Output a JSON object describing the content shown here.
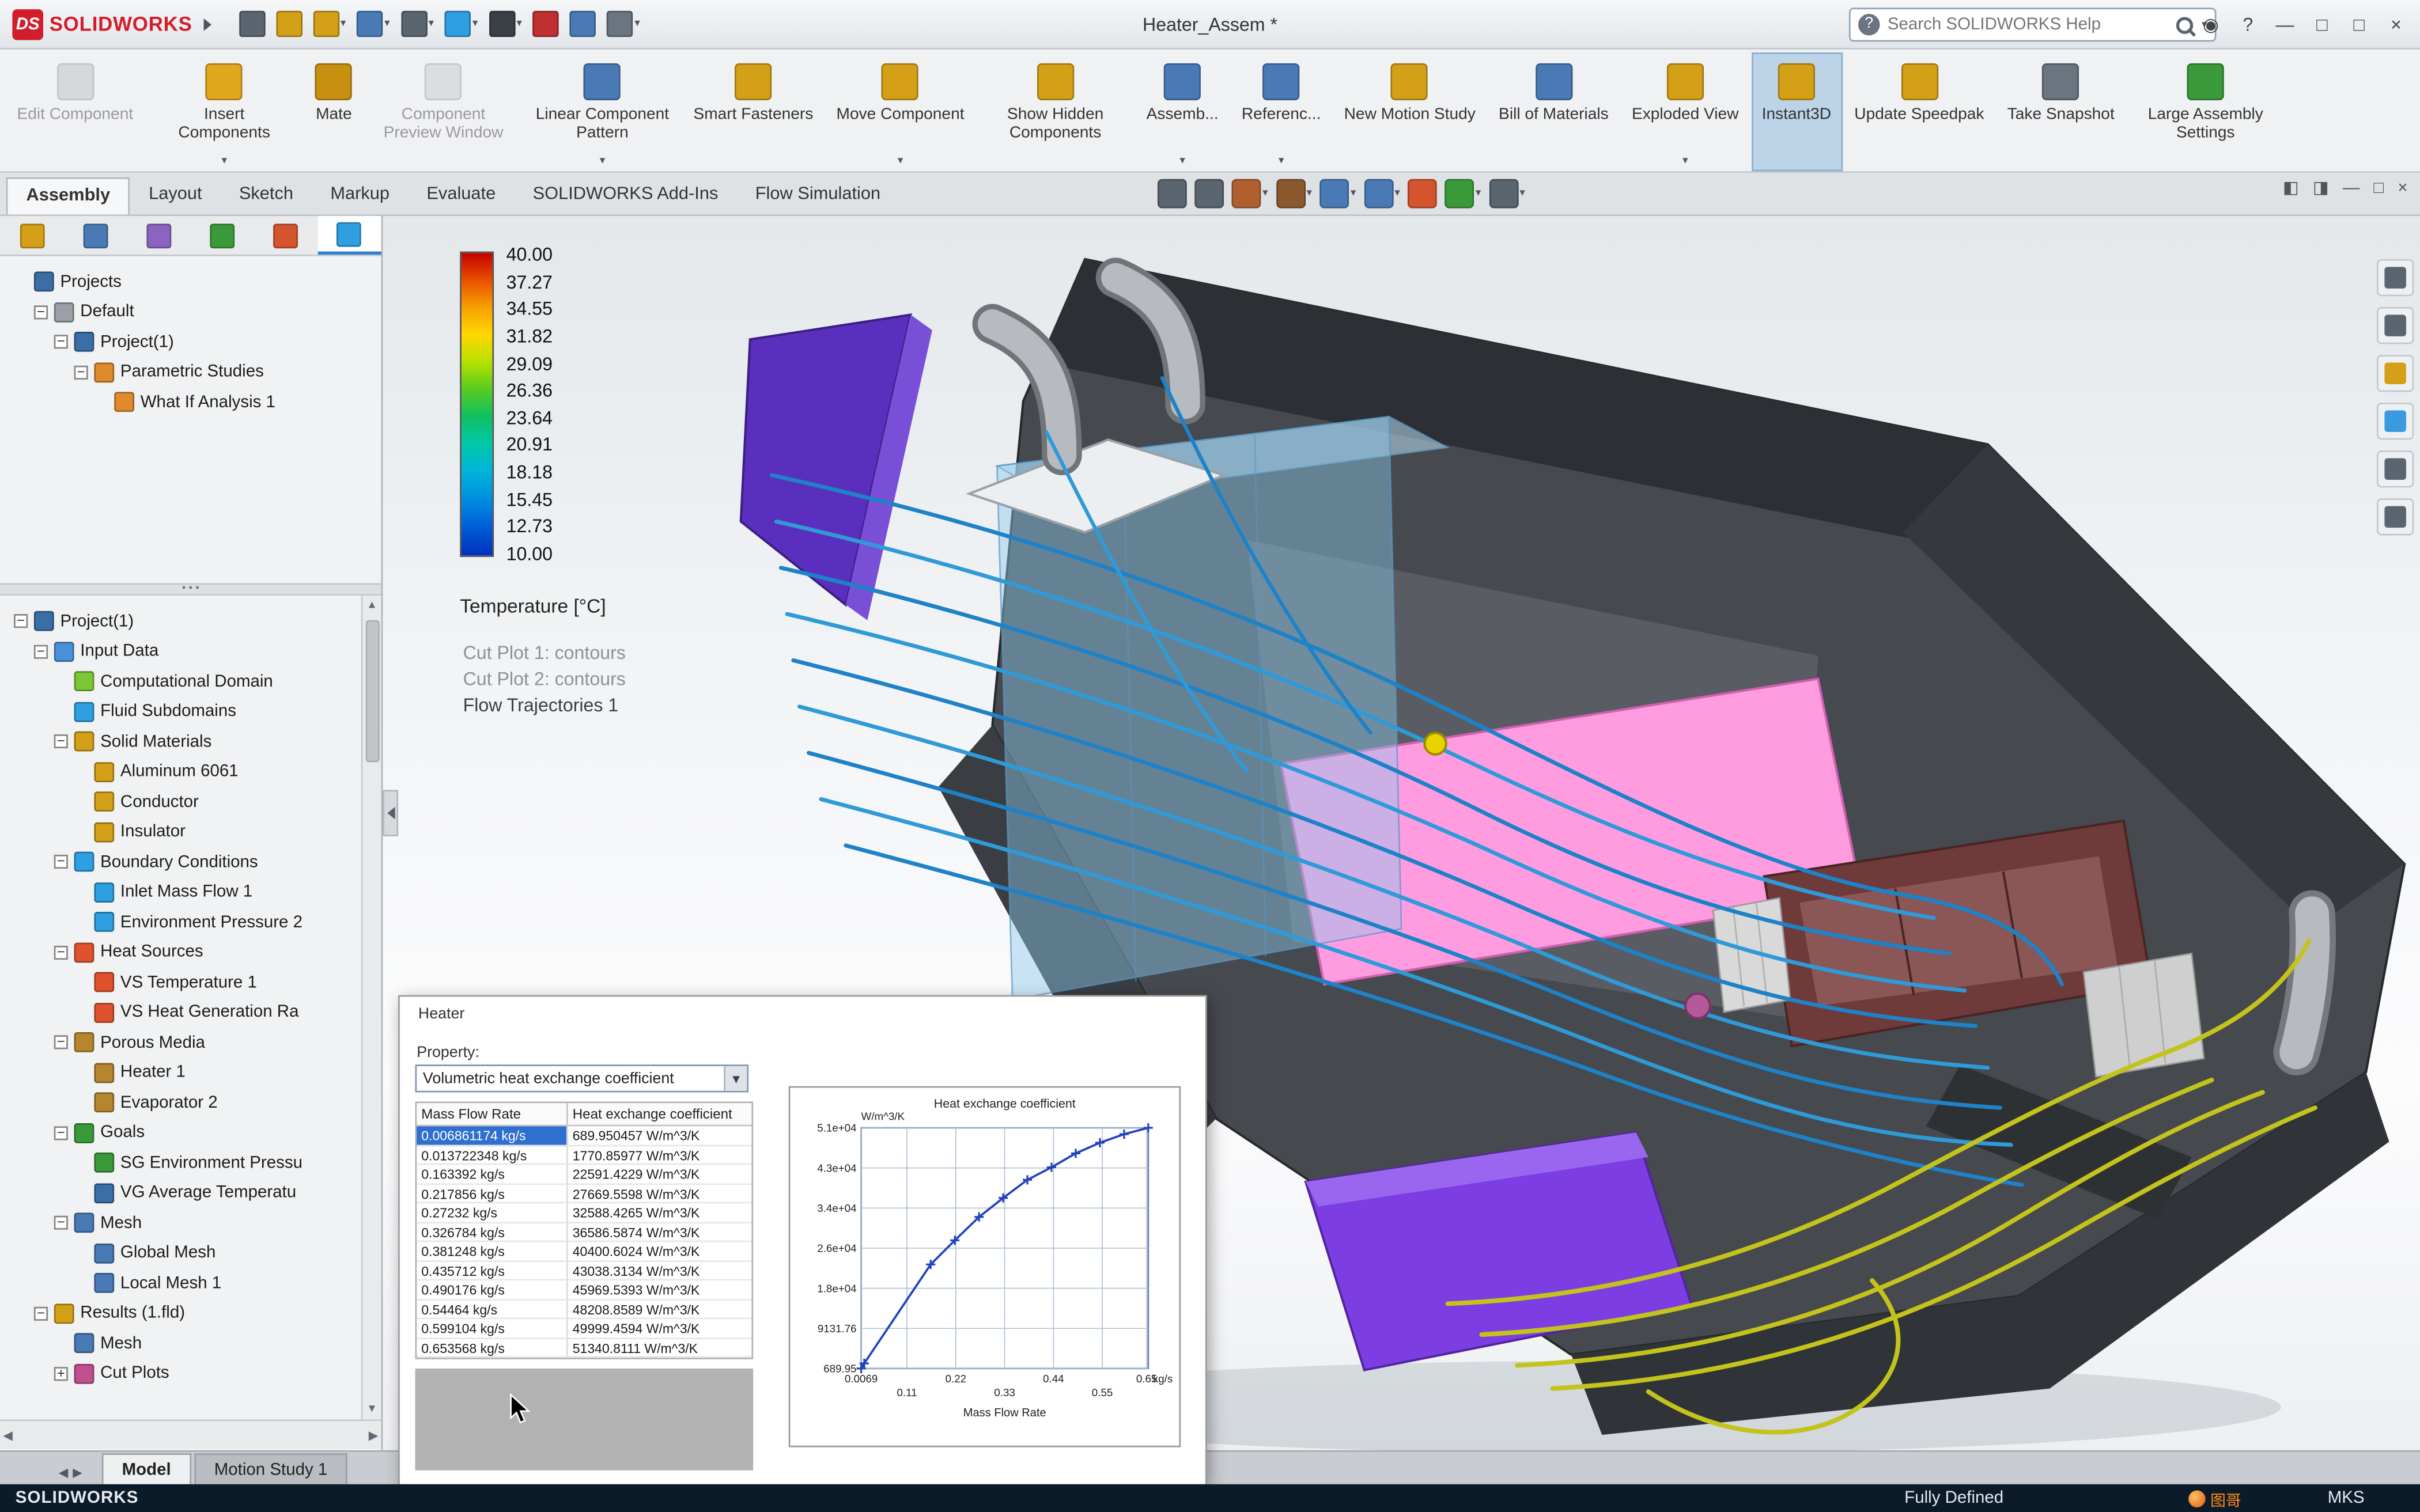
{
  "titlebar": {
    "brand_mark": "DS",
    "brand": "SOLIDWORKS",
    "title": "Heater_Assem *",
    "search": {
      "placeholder": "Search SOLIDWORKS Help",
      "help_glyph": "?"
    },
    "tool_icons": [
      {
        "icon": "home-icon",
        "color": "#5a6570"
      },
      {
        "icon": "new-document-icon",
        "color": "#d4a017"
      },
      {
        "icon": "open-icon",
        "color": "#d4a017",
        "dropdown": true
      },
      {
        "icon": "save-icon",
        "color": "#4a7ab5",
        "dropdown": true
      },
      {
        "icon": "print-icon",
        "color": "#5a6570",
        "dropdown": true
      },
      {
        "icon": "undo-icon",
        "color": "#2e9fe0",
        "dropdown": true
      },
      {
        "icon": "select-arrow-icon",
        "color": "#3b4046",
        "dropdown": true
      },
      {
        "icon": "mate-reference-icon",
        "color": "#c03030"
      },
      {
        "icon": "design-table-icon",
        "color": "#4a7ab5"
      },
      {
        "icon": "options-gear-icon",
        "color": "#6a7580",
        "dropdown": true
      }
    ],
    "window_controls": [
      {
        "icon": "user-icon",
        "glyph": "◉"
      },
      {
        "icon": "help-icon",
        "glyph": "?"
      },
      {
        "icon": "minimize-icon",
        "glyph": "—"
      },
      {
        "icon": "restore-icon",
        "glyph": "□"
      },
      {
        "icon": "maximize-icon",
        "glyph": "□"
      },
      {
        "icon": "close-icon",
        "glyph": "×"
      }
    ]
  },
  "ribbon": [
    {
      "label": "Edit Component",
      "icon": "edit-component-icon",
      "color": "#b9bcc0",
      "disabled": true
    },
    {
      "label": "Insert Components",
      "icon": "insert-components-icon",
      "color": "#e0a81f",
      "dropdown": true
    },
    {
      "label": "Mate",
      "icon": "mate-icon",
      "color": "#c89010"
    },
    {
      "label": "Component Preview Window",
      "icon": "component-preview-window-icon",
      "color": "#c3c6ca",
      "disabled": true
    },
    {
      "label": "Linear Component Pattern",
      "icon": "linear-component-pattern-icon",
      "color": "#4a7ab5",
      "dropdown": true
    },
    {
      "label": "Smart Fasteners",
      "icon": "smart-fasteners-icon",
      "color": "#d4a017"
    },
    {
      "label": "Move Component",
      "icon": "move-component-icon",
      "color": "#d4a017",
      "dropdown": true
    },
    {
      "label": "Show Hidden Components",
      "icon": "show-hidden-components-icon",
      "color": "#d4a017"
    },
    {
      "label": "Assemb...",
      "icon": "assembly-features-icon",
      "color": "#4a7ab5",
      "dropdown": true
    },
    {
      "label": "Referenc...",
      "icon": "reference-geometry-icon",
      "color": "#4a7ab5",
      "dropdown": true
    },
    {
      "label": "New Motion Study",
      "icon": "new-motion-study-icon",
      "color": "#d4a017"
    },
    {
      "label": "Bill of Materials",
      "icon": "bill-of-materials-icon",
      "color": "#4a7ab5"
    },
    {
      "label": "Exploded View",
      "icon": "exploded-view-icon",
      "color": "#d4a017",
      "dropdown": true
    },
    {
      "label": "Instant3D",
      "icon": "instant3d-icon",
      "color": "#d4a017",
      "active": true
    },
    {
      "label": "Update Speedpak",
      "icon": "update-speedpak-icon",
      "color": "#d4a017"
    },
    {
      "label": "Take Snapshot",
      "icon": "take-snapshot-icon",
      "color": "#6a7580"
    },
    {
      "label": "Large Assembly Settings",
      "icon": "large-assembly-settings-icon",
      "color": "#3a9a3a"
    }
  ],
  "doc_tabs": [
    {
      "label": "Assembly",
      "active": true
    },
    {
      "label": "Layout"
    },
    {
      "label": "Sketch"
    },
    {
      "label": "Markup"
    },
    {
      "label": "Evaluate"
    },
    {
      "label": "SOLIDWORKS Add-Ins"
    },
    {
      "label": "Flow Simulation"
    }
  ],
  "hud_icons": [
    {
      "icon": "zoom-fit-icon",
      "color": "#5a6570"
    },
    {
      "icon": "zoom-area-icon",
      "color": "#5a6570"
    },
    {
      "icon": "section-view-icon",
      "color": "#b06030",
      "dropdown": true
    },
    {
      "icon": "view-orientation-icon",
      "color": "#8a5a2e",
      "dropdown": true
    },
    {
      "icon": "display-style-icon",
      "color": "#4a7ab5",
      "dropdown": true
    },
    {
      "icon": "hide-show-icon",
      "color": "#4a7ab5",
      "dropdown": true
    },
    {
      "icon": "appearance-icon",
      "color": "#d4542e"
    },
    {
      "icon": "scene-icon",
      "color": "#3a9a3a",
      "dropdown": true
    },
    {
      "icon": "view-settings-icon",
      "color": "#5a6570",
      "dropdown": true
    }
  ],
  "docwin_controls": [
    {
      "icon": "pane-left-icon",
      "glyph": "◧"
    },
    {
      "icon": "pane-right-icon",
      "glyph": "◨"
    },
    {
      "icon": "minimize-doc-icon",
      "glyph": "—"
    },
    {
      "icon": "restore-doc-icon",
      "glyph": "□"
    },
    {
      "icon": "close-doc-icon",
      "glyph": "×"
    }
  ],
  "panel_tabs": [
    {
      "icon": "featuremanager-tab-icon",
      "color": "#d4a017"
    },
    {
      "icon": "propertymanager-tab-icon",
      "color": "#4a7ab5"
    },
    {
      "icon": "configurationmanager-tab-icon",
      "color": "#8a64c0"
    },
    {
      "icon": "dimxpertmanager-tab-icon",
      "color": "#3a9a3a"
    },
    {
      "icon": "displaymanager-tab-icon",
      "color": "#d4542e"
    },
    {
      "icon": "flow-simulation-tab-icon",
      "color": "#2e9fe0",
      "active": true
    }
  ],
  "tree1": [
    {
      "label": "Projects",
      "depth": 0,
      "twisty": "",
      "color": "#3a6ea5",
      "icon": "projects-icon"
    },
    {
      "label": "Default",
      "depth": 1,
      "twisty": "minus",
      "color": "#9aa0a6",
      "icon": "default-config-icon"
    },
    {
      "label": "Project(1)",
      "depth": 2,
      "twisty": "minus",
      "color": "#3a6ea5",
      "icon": "project-icon"
    },
    {
      "label": "Parametric Studies",
      "depth": 3,
      "twisty": "minus",
      "color": "#e08a2e",
      "icon": "parametric-studies-icon"
    },
    {
      "label": "What If Analysis 1",
      "depth": 4,
      "twisty": "",
      "color": "#e08a2e",
      "icon": "what-if-analysis-icon"
    }
  ],
  "tree2": [
    {
      "label": "Project(1)",
      "depth": 0,
      "twisty": "minus",
      "color": "#3a6ea5",
      "icon": "project-icon"
    },
    {
      "label": "Input Data",
      "depth": 1,
      "twisty": "minus",
      "color": "#4a90d9",
      "icon": "input-data-icon"
    },
    {
      "label": "Computational Domain",
      "depth": 2,
      "twisty": "",
      "color": "#7ec636",
      "icon": "computational-domain-icon"
    },
    {
      "label": "Fluid Subdomains",
      "depth": 2,
      "twisty": "",
      "color": "#2e9fe0",
      "icon": "fluid-subdomains-icon"
    },
    {
      "label": "Solid Materials",
      "depth": 2,
      "twisty": "minus",
      "color": "#d4a017",
      "icon": "solid-materials-icon"
    },
    {
      "label": "Aluminum 6061",
      "depth": 3,
      "twisty": "",
      "color": "#d4a017",
      "icon": "material-icon"
    },
    {
      "label": "Conductor",
      "depth": 3,
      "twisty": "",
      "color": "#d4a017",
      "icon": "material-icon"
    },
    {
      "label": "Insulator",
      "depth": 3,
      "twisty": "",
      "color": "#d4a017",
      "icon": "material-icon"
    },
    {
      "label": "Boundary Conditions",
      "depth": 2,
      "twisty": "minus",
      "color": "#2e9fe0",
      "icon": "boundary-conditions-icon"
    },
    {
      "label": "Inlet Mass Flow 1",
      "depth": 3,
      "twisty": "",
      "color": "#2e9fe0",
      "icon": "inlet-mass-flow-icon"
    },
    {
      "label": "Environment Pressure 2",
      "depth": 3,
      "twisty": "",
      "color": "#2e9fe0",
      "icon": "environment-pressure-icon"
    },
    {
      "label": "Heat Sources",
      "depth": 2,
      "twisty": "minus",
      "color": "#e0522e",
      "icon": "heat-sources-icon"
    },
    {
      "label": "VS Temperature 1",
      "depth": 3,
      "twisty": "",
      "color": "#e0522e",
      "icon": "vs-temperature-icon"
    },
    {
      "label": "VS Heat Generation Ra",
      "depth": 3,
      "twisty": "",
      "color": "#e0522e",
      "icon": "vs-heat-generation-icon"
    },
    {
      "label": "Porous Media",
      "depth": 2,
      "twisty": "minus",
      "color": "#b5862e",
      "icon": "porous-media-icon"
    },
    {
      "label": "Heater 1",
      "depth": 3,
      "twisty": "",
      "color": "#b5862e",
      "icon": "porous-medium-icon"
    },
    {
      "label": "Evaporator 2",
      "depth": 3,
      "twisty": "",
      "color": "#b5862e",
      "icon": "porous-medium-icon"
    },
    {
      "label": "Goals",
      "depth": 2,
      "twisty": "minus",
      "color": "#3a9a3a",
      "icon": "goals-icon"
    },
    {
      "label": "SG Environment Pressu",
      "depth": 3,
      "twisty": "",
      "color": "#3a9a3a",
      "icon": "surface-goal-icon"
    },
    {
      "label": "VG Average Temperatu",
      "depth": 3,
      "twisty": "",
      "color": "#3a6ea5",
      "icon": "volume-goal-icon"
    },
    {
      "label": "Mesh",
      "depth": 2,
      "twisty": "minus",
      "color": "#4a7ab5",
      "icon": "mesh-icon"
    },
    {
      "label": "Global Mesh",
      "depth": 3,
      "twisty": "",
      "color": "#4a7ab5",
      "icon": "global-mesh-icon"
    },
    {
      "label": "Local Mesh 1",
      "depth": 3,
      "twisty": "",
      "color": "#4a7ab5",
      "icon": "local-mesh-icon"
    },
    {
      "label": "Results (1.fld)",
      "depth": 1,
      "twisty": "minus",
      "color": "#d4a017",
      "icon": "results-icon"
    },
    {
      "label": "Mesh",
      "depth": 2,
      "twisty": "",
      "color": "#4a7ab5",
      "icon": "mesh-icon"
    },
    {
      "label": "Cut Plots",
      "depth": 2,
      "twisty": "plus",
      "color": "#c05090",
      "icon": "cut-plots-icon"
    }
  ],
  "legend": {
    "values": [
      "40.00",
      "37.27",
      "34.55",
      "31.82",
      "29.09",
      "26.36",
      "23.64",
      "20.91",
      "18.18",
      "15.45",
      "12.73",
      "10.00"
    ],
    "title": "Temperature [°C]",
    "annotations": [
      {
        "label": "Cut Plot 1: contours",
        "muted": true
      },
      {
        "label": "Cut Plot 2: contours",
        "muted": true
      },
      {
        "label": "Flow Trajectories 1",
        "muted": false
      }
    ]
  },
  "right_tools": [
    {
      "icon": "view-home-icon",
      "color": "#5a6570"
    },
    {
      "icon": "batch-results-icon",
      "color": "#5a6570"
    },
    {
      "icon": "open-folder-icon",
      "color": "#d4a017"
    },
    {
      "icon": "appearance-sphere-icon",
      "color": "#3a9ae0"
    },
    {
      "icon": "display-pane-icon",
      "color": "#5a6570"
    },
    {
      "icon": "snapshot-camera-icon",
      "color": "#5a6570"
    }
  ],
  "dialog": {
    "title": "Heater",
    "property_label": "Property:",
    "property_value": "Volumetric heat exchange coefficient",
    "table": {
      "headers": [
        "Mass Flow Rate",
        "Heat exchange coefficient"
      ],
      "rows": [
        {
          "flow": "0.006861174 kg/s",
          "coeff": "689.950457 W/m^3/K",
          "selected": true
        },
        {
          "flow": "0.013722348 kg/s",
          "coeff": "1770.85977 W/m^3/K"
        },
        {
          "flow": "0.163392 kg/s",
          "coeff": "22591.4229 W/m^3/K"
        },
        {
          "flow": "0.217856 kg/s",
          "coeff": "27669.5598 W/m^3/K"
        },
        {
          "flow": "0.27232 kg/s",
          "coeff": "32588.4265 W/m^3/K"
        },
        {
          "flow": "0.326784 kg/s",
          "coeff": "36586.5874 W/m^3/K"
        },
        {
          "flow": "0.381248 kg/s",
          "coeff": "40400.6024 W/m^3/K"
        },
        {
          "flow": "0.435712 kg/s",
          "coeff": "43038.3134 W/m^3/K"
        },
        {
          "flow": "0.490176 kg/s",
          "coeff": "45969.5393 W/m^3/K"
        },
        {
          "flow": "0.54464 kg/s",
          "coeff": "48208.8589 W/m^3/K"
        },
        {
          "flow": "0.599104 kg/s",
          "coeff": "49999.4594 W/m^3/K"
        },
        {
          "flow": "0.653568 kg/s",
          "coeff": "51340.8111 W/m^3/K"
        }
      ]
    },
    "chart": {
      "title": "Heat exchange coefficient",
      "y_unit": "W/m^3/K",
      "x_unit": "kg/s",
      "x_label": "Mass Flow Rate",
      "xmin": 0.0069,
      "xmax": 0.653568,
      "ymin": 689.95,
      "ymax": 51340.8111,
      "x": [
        0.006861174,
        0.013722348,
        0.163392,
        0.217856,
        0.27232,
        0.326784,
        0.381248,
        0.435712,
        0.490176,
        0.54464,
        0.599104,
        0.653568
      ],
      "y": [
        689.950457,
        1770.85977,
        22591.4229,
        27669.5598,
        32588.4265,
        36586.5874,
        40400.6024,
        43038.3134,
        45969.5393,
        48208.8589,
        49999.4594,
        51340.8111
      ],
      "y_ticks": [
        {
          "label": "5.1e+04",
          "v": 51340.8111
        },
        {
          "label": "4.3e+04",
          "v": 42899.0
        },
        {
          "label": "3.4e+04",
          "v": 34457.2
        },
        {
          "label": "2.6e+04",
          "v": 26015.4
        },
        {
          "label": "1.8e+04",
          "v": 17573.6
        },
        {
          "label": "9131.76",
          "v": 9131.76
        },
        {
          "label": "689.95",
          "v": 689.95
        }
      ],
      "x_ticks": [
        {
          "label": "0.0069",
          "v": 0.0069,
          "row": 0
        },
        {
          "label": "0.11",
          "v": 0.11,
          "row": 1
        },
        {
          "label": "0.22",
          "v": 0.22,
          "row": 0
        },
        {
          "label": "0.33",
          "v": 0.33,
          "row": 1
        },
        {
          "label": "0.44",
          "v": 0.44,
          "row": 0
        },
        {
          "label": "0.55",
          "v": 0.55,
          "row": 1
        },
        {
          "label": "0.65",
          "v": 0.65,
          "row": 0
        }
      ]
    }
  },
  "chart_data": {
    "type": "line",
    "title": "Heat exchange coefficient",
    "xlabel": "Mass Flow Rate",
    "ylabel": "W/m^3/K",
    "x_unit": "kg/s",
    "x": [
      0.006861174,
      0.013722348,
      0.163392,
      0.217856,
      0.27232,
      0.326784,
      0.381248,
      0.435712,
      0.490176,
      0.54464,
      0.599104,
      0.653568
    ],
    "y": [
      689.950457,
      1770.85977,
      22591.4229,
      27669.5598,
      32588.4265,
      36586.5874,
      40400.6024,
      43038.3134,
      45969.5393,
      48208.8589,
      49999.4594,
      51340.8111
    ],
    "xlim": [
      0.0069,
      0.65
    ],
    "ylim": [
      689.95,
      51340.8111
    ]
  },
  "bottom_tabs": {
    "nav": [
      {
        "icon": "tab-scroll-left-icon",
        "glyph": "◀"
      },
      {
        "icon": "tab-scroll-right-icon",
        "glyph": "▶"
      }
    ],
    "tabs": [
      {
        "label": "Model",
        "active": true
      },
      {
        "label": "Motion Study 1"
      }
    ]
  },
  "statusbar": {
    "app": "SOLIDWORKS",
    "status": "Fully Defined",
    "units": "MKS",
    "watermark": "图哥"
  }
}
